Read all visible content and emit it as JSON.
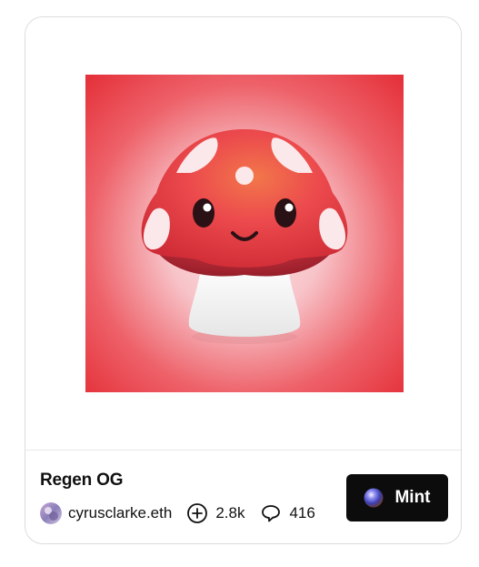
{
  "artwork": {
    "icon": "mushroom-character-illustration",
    "background_color": "#e8323c",
    "cap_color": "#e8404a",
    "stem_color": "#f4f4f4"
  },
  "token": {
    "title": "Regen OG"
  },
  "creator": {
    "name": "cyrusclarke.eth",
    "avatar_icon": "avatar-icon"
  },
  "stats": {
    "collects": "2.8k",
    "collects_icon": "plus-circle-icon",
    "comments": "416",
    "comments_icon": "comment-icon"
  },
  "actions": {
    "mint_label": "Mint",
    "mint_icon": "orb-icon",
    "mint_button_color": "#0c0c0c"
  }
}
